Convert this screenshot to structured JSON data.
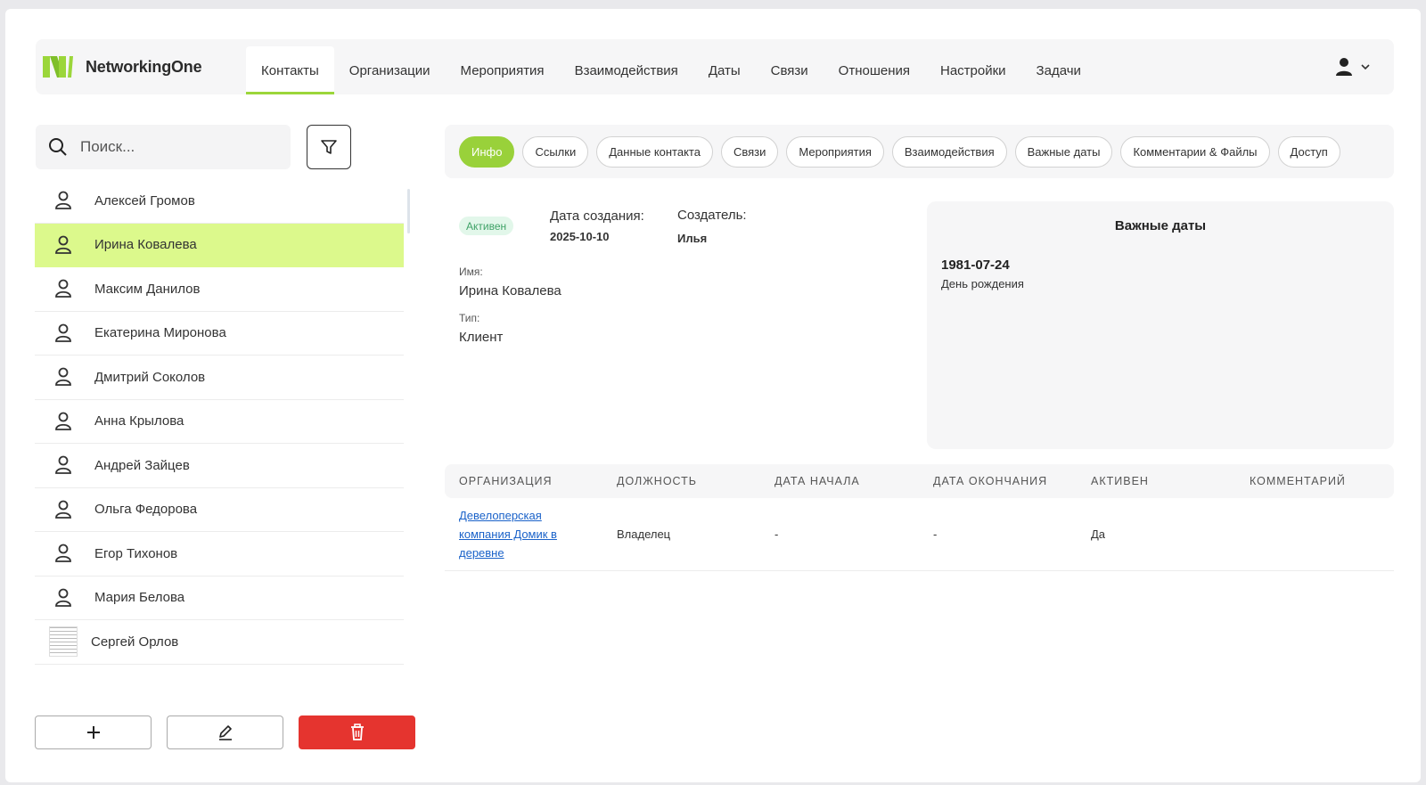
{
  "app": {
    "name": "NetworkingOne",
    "accent_color": "#9bd63a",
    "selected_color": "#dcf98c",
    "danger_color": "#e5342f"
  },
  "nav": {
    "items": [
      {
        "label": "Контакты",
        "active": true
      },
      {
        "label": "Организации"
      },
      {
        "label": "Мероприятия"
      },
      {
        "label": "Взаимодействия"
      },
      {
        "label": "Даты"
      },
      {
        "label": "Связи"
      },
      {
        "label": "Отношения"
      },
      {
        "label": "Настройки"
      },
      {
        "label": "Задачи"
      }
    ],
    "user_icon": "user-icon",
    "dropdown_icon": "chevron-down-icon"
  },
  "search": {
    "placeholder": "Поиск...",
    "icon": "search-icon",
    "filter_icon": "filter-icon"
  },
  "contacts": [
    {
      "name": "Алексей Громов"
    },
    {
      "name": "Ирина Ковалева",
      "selected": true
    },
    {
      "name": "Максим Данилов"
    },
    {
      "name": "Екатерина Миронова"
    },
    {
      "name": "Дмитрий Соколов"
    },
    {
      "name": "Анна Крылова"
    },
    {
      "name": "Андрей Зайцев"
    },
    {
      "name": "Ольга Федорова"
    },
    {
      "name": "Егор Тихонов"
    },
    {
      "name": "Мария Белова"
    },
    {
      "name": "Сергей Орлов",
      "has_photo": true
    }
  ],
  "actions": {
    "add_icon": "plus-icon",
    "edit_icon": "pencil-icon",
    "delete_icon": "trash-icon"
  },
  "tabs": [
    {
      "label": "Инфо",
      "active": true
    },
    {
      "label": "Ссылки"
    },
    {
      "label": "Данные контакта"
    },
    {
      "label": "Связи"
    },
    {
      "label": "Мероприятия"
    },
    {
      "label": "Взаимодействия"
    },
    {
      "label": "Важные даты"
    },
    {
      "label": "Комментарии & Файлы"
    },
    {
      "label": "Доступ"
    }
  ],
  "info": {
    "status": "Активен",
    "created_label": "Дата создания:",
    "created_value": "2025-10-10",
    "creator_label": "Создатель:",
    "creator_value": "Илья",
    "name_label": "Имя:",
    "name_value": "Ирина Ковалева",
    "type_label": "Тип:",
    "type_value": "Клиент"
  },
  "important_dates": {
    "title": "Важные даты",
    "items": [
      {
        "date": "1981-07-24",
        "label": "День рождения"
      }
    ]
  },
  "positions_table": {
    "headers": [
      "ОРГАНИЗАЦИЯ",
      "ДОЛЖНОСТЬ",
      "ДАТА НАЧАЛА",
      "ДАТА ОКОНЧАНИЯ",
      "АКТИВЕН",
      "КОММЕНТАРИЙ"
    ],
    "rows": [
      {
        "organization": "Девелоперская компания Домик в деревне",
        "position": "Владелец",
        "start": "-",
        "end": "-",
        "active": "Да",
        "comment": ""
      }
    ]
  }
}
